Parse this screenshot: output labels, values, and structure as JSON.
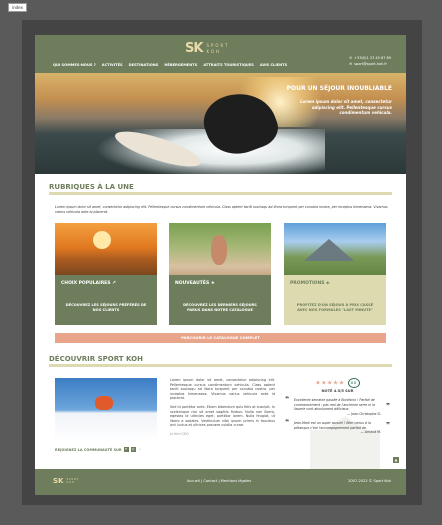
{
  "tab_label": "index",
  "header": {
    "logo_mark": "SK",
    "logo_line1": "SPORT",
    "logo_line2": "KOH",
    "nav": [
      "QUI SOMMES-NOUS ?",
      "ACTIVITÉS",
      "DESTINATIONS",
      "HÉBERGEMENTS",
      "ATTRAITS TOURISTIQUES",
      "AVIS CLIENTS"
    ],
    "phone": "+33(0)1 23 45 67 89",
    "email": "sport@sport-koh.fr"
  },
  "hero": {
    "title": "POUR UN SÉJOUR INOUBLIABLE",
    "subtitle": "Lorem ipsum dolor sit amet, consectetur adipiscing elit. Pellentesque cursus condimentum vehicula."
  },
  "rubriques": {
    "title": "RUBRIQUES À LA UNE",
    "intro": "Lorem ipsum dolor sit amet, consectetur adipiscing elit. Pellentesque cursus condimentum vehicula. Class aptent taciti sociosqu ad litora torquent per conubia nostra, per inceptos himenaeos. Vivamus varius vehicula ante id placerat.",
    "cards": [
      {
        "label": "CHOIX POPULAIRES ↗",
        "text": "DÉCOUVREZ LES SÉJOURS PRÉFÉRÉS DE NOS CLIENTS"
      },
      {
        "label": "NOUVEAUTÉS ★",
        "text": "DÉCOUVREZ LES DERNIERS SÉJOURS PARUS DANS NOTRE CATALOGUE"
      },
      {
        "label": "PROMOTIONS ◈",
        "text": "PROFITEZ D'UN SÉJOUR À PRIX CASSÉ AVEC NOS FORMULES \"LAST MINUTE\""
      }
    ],
    "cta": "PARCOURIR LE CATALOGUE COMPLET"
  },
  "about": {
    "title": "DÉCOUVRIR SPORT KOH",
    "p1": "Lorem ipsum dolor sit amet, consectetur adipiscing elit. Pellentesque cursus condimentum vehicula. Class aptent taciti sociosqu ad litora torquent per conubia nostra, per inceptos himenaeos. Vivamus varius vehicula ante id placerat.",
    "p2": "Sed id porttitor ante. Etiam bibendum quis felis at suscipit. In scelerisque nisi sit amet sagittis finibus. Nulla non libero, egestas id ultricies eget, porttitor lorem. Nulla feugiat, ut libero a sodales. Vestibulum nibh ipsum primis in faucibus orci luctus et ultrices posuere cubilia curae.",
    "signature": "Jo Koh CEO",
    "join": "REJOIGNEZ LA COMMUNAUTÉ SUR"
  },
  "reviews": {
    "stars": "★★★★★",
    "noted": "NOTÉ 4.5/5 SUR",
    "q1": "Excellente semaine passée à Bonifacio ! Parfait de commencement : pas mal de l'ancienne serre ni la lisserie vont absolument délicieux.",
    "a1": "— Jean-Christophe D.",
    "q2": "Jean-Mark est un super accueil ! Bien venus à la pétanque c'est l'accompagnement parfait de.",
    "a2": "— Arnaud M."
  },
  "footer": {
    "links": "Accueil | Contact | Mentions légales",
    "copyright": "2007-2022 © Sport Koh"
  },
  "colors": {
    "brand": "#6e7e5c",
    "accent": "#e8a58a",
    "cream": "#dedab0"
  }
}
